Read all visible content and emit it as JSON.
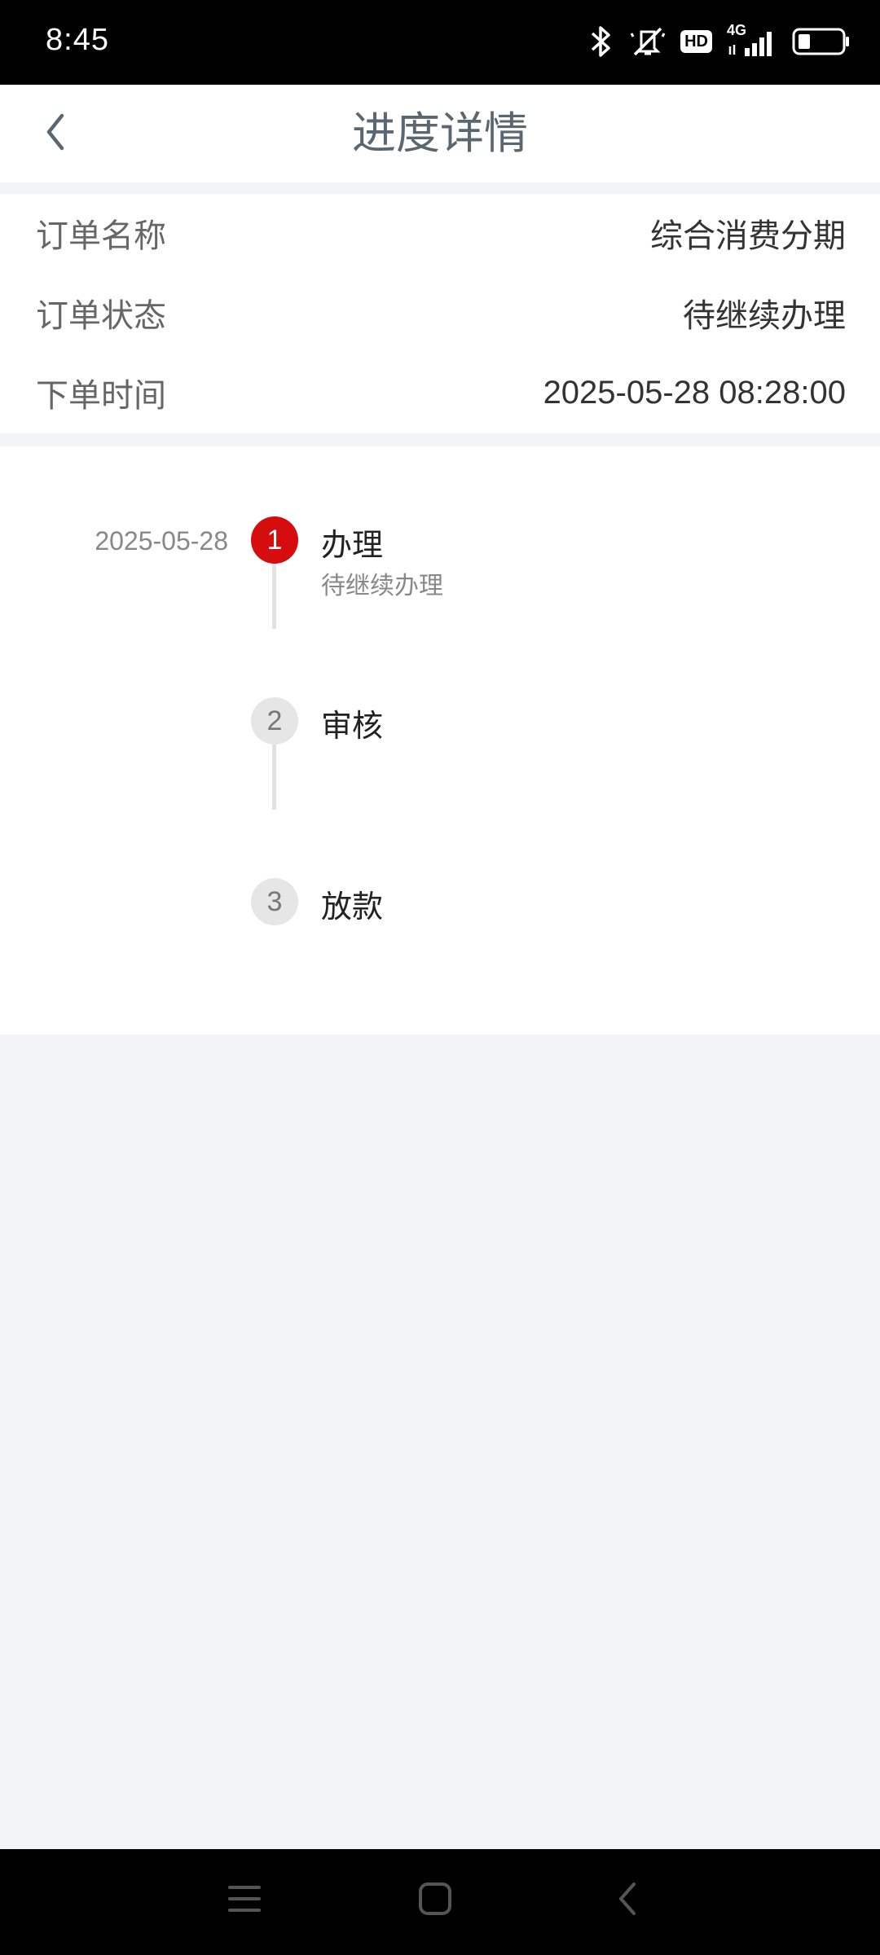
{
  "status_bar": {
    "time": "8:45",
    "icons": [
      "bluetooth-icon",
      "mute-icon",
      "hd-icon",
      "signal-4g-icon",
      "battery-icon"
    ],
    "hd_label": "HD",
    "network_label": "4G"
  },
  "header": {
    "title": "进度详情",
    "back_icon": "chevron-left-icon"
  },
  "order_info": {
    "rows": [
      {
        "label": "订单名称",
        "value": "综合消费分期"
      },
      {
        "label": "订单状态",
        "value": "待继续办理"
      },
      {
        "label": "下单时间",
        "value": "2025-05-28 08:28:00"
      }
    ]
  },
  "progress": {
    "steps": [
      {
        "number": "1",
        "title": "办理",
        "subtitle": "待继续办理",
        "date": "2025-05-28",
        "active": true
      },
      {
        "number": "2",
        "title": "审核",
        "subtitle": "",
        "date": "",
        "active": false
      },
      {
        "number": "3",
        "title": "放款",
        "subtitle": "",
        "date": "",
        "active": false
      }
    ]
  },
  "colors": {
    "accent": "#d50d0f",
    "title": "#5b6770",
    "background": "#f3f4f6"
  },
  "nav_bar": {
    "icons": [
      "menu-icon",
      "home-square-icon",
      "back-triangle-icon"
    ]
  }
}
